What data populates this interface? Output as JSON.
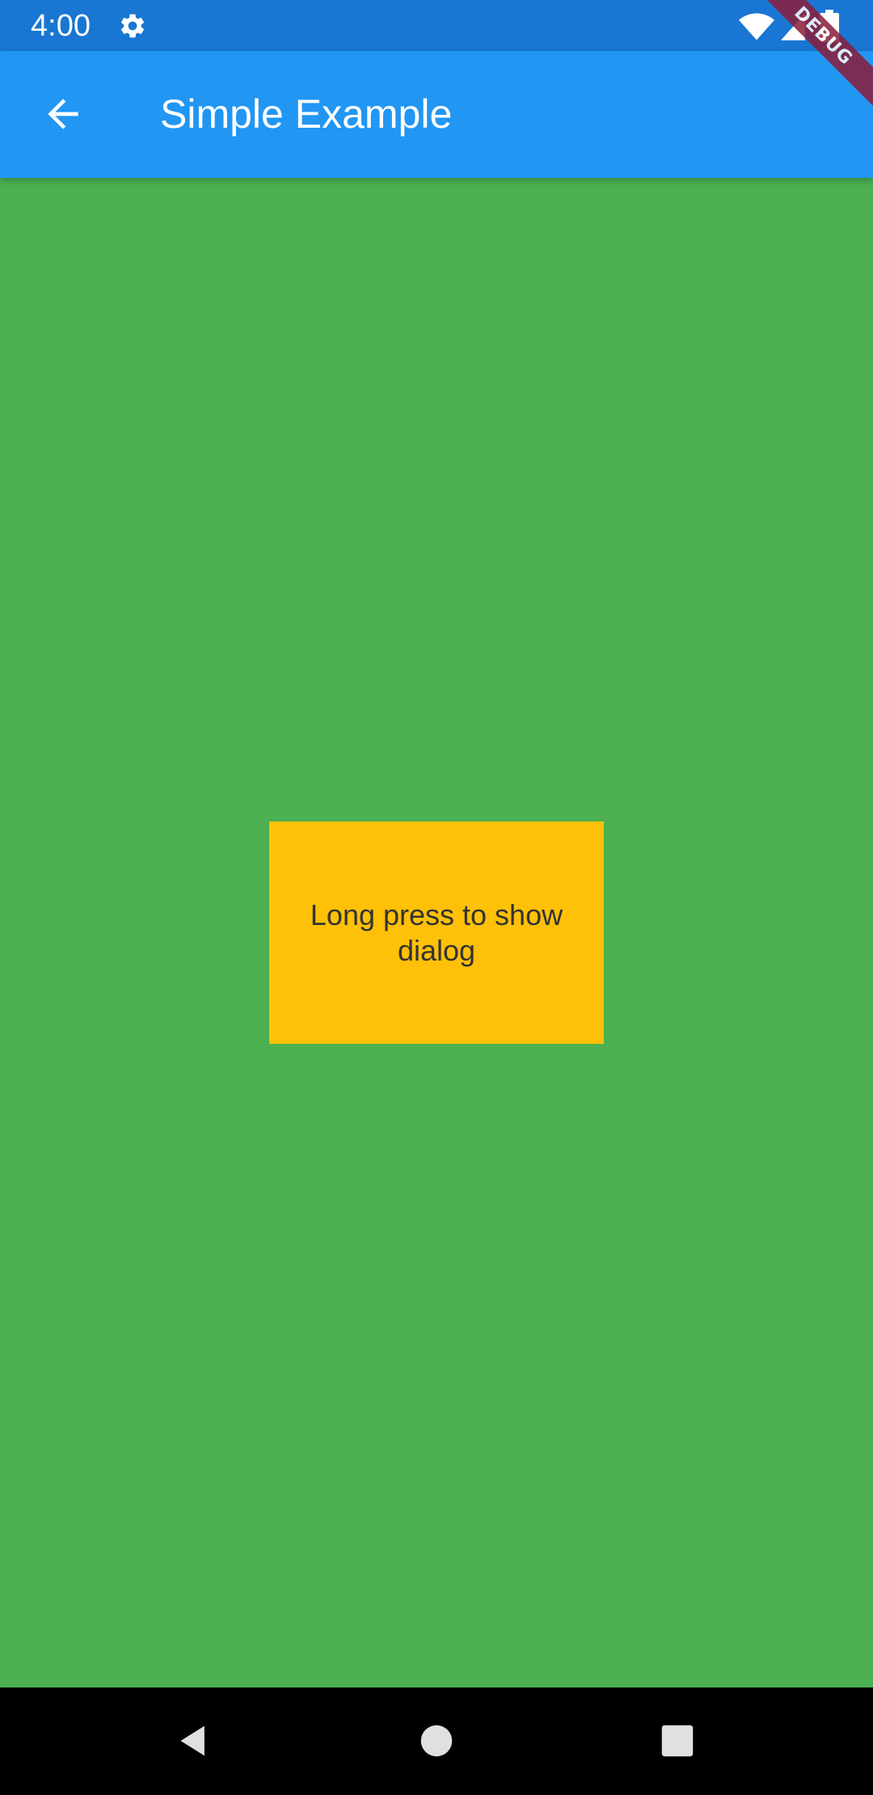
{
  "status_bar": {
    "time": "4:00",
    "icons": [
      "gear-icon",
      "wifi-icon",
      "signal-icon",
      "battery-icon"
    ]
  },
  "app_bar": {
    "title": "Simple Example",
    "back_icon": "arrow-back-icon"
  },
  "debug_banner": {
    "label": "DEBUG"
  },
  "main": {
    "box_label": "Long press to show dialog"
  },
  "nav_bar": {
    "icons": [
      "nav-back-icon",
      "nav-home-icon",
      "nav-recents-icon"
    ]
  },
  "colors": {
    "status_bar": "#1976d2",
    "app_bar": "#2196f3",
    "background": "#4caf50",
    "box": "#ffc107",
    "banner": "#8b1d3a",
    "nav_bar": "#000000"
  }
}
